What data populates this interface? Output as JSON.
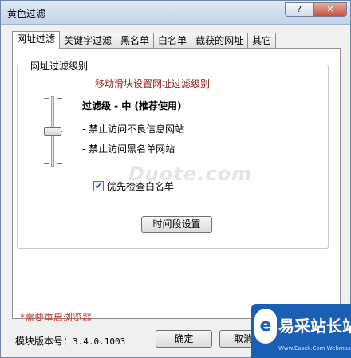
{
  "window": {
    "title": "黄色过滤",
    "help_label": "?",
    "close_label": "✕"
  },
  "tabs": [
    {
      "label": "网址过滤"
    },
    {
      "label": "关键字过滤"
    },
    {
      "label": "黑名单"
    },
    {
      "label": "白名单"
    },
    {
      "label": "截获的网址"
    },
    {
      "label": "其它"
    }
  ],
  "panel": {
    "group_label": "网址过滤级别",
    "hint": "移动滑块设置网址过滤级别",
    "slider_level": "中",
    "level_title": "过滤级 - 中 (推荐使用)",
    "bullets": [
      "- 禁止访问不良信息网站",
      "- 禁止访问黑名单网站"
    ],
    "checkbox": {
      "label": "优先检查白名单",
      "checked": true
    },
    "time_button": "时间段设置"
  },
  "footer": {
    "restart_note": "*需要重启浏览器",
    "version_label": "模块版本号：",
    "version_value": "3.4.0.1003",
    "ok": "确定",
    "cancel": "取消"
  },
  "watermark": "Duote.com",
  "logo": {
    "cn": "易采站长站",
    "en": "Www.Easck.Com Webmaster"
  }
}
